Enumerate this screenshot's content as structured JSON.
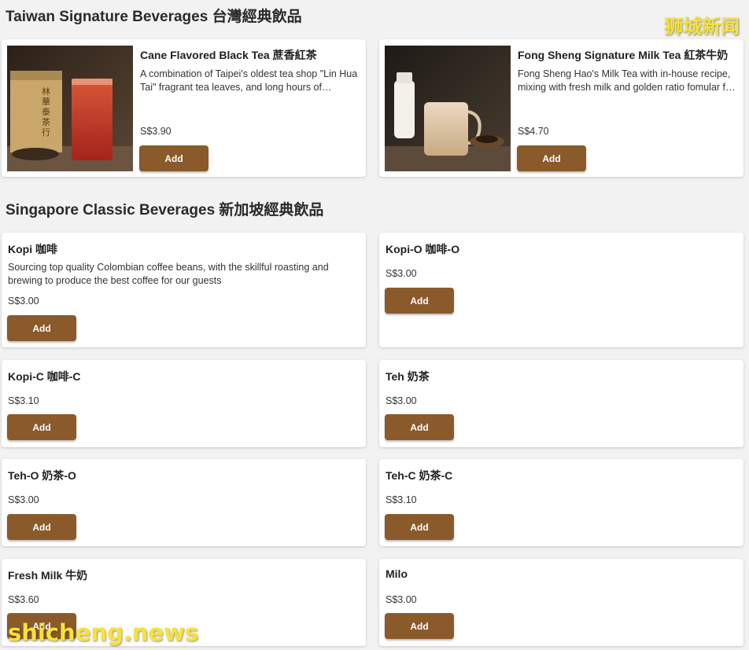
{
  "sections": {
    "taiwan": {
      "title": "Taiwan Signature Beverages 台灣經典飲品"
    },
    "singapore": {
      "title": "Singapore Classic Beverages 新加坡經典飲品"
    }
  },
  "add_label": "Add",
  "taiwan_items": [
    {
      "name": "Cane Flavored Black Tea 蔗香紅茶",
      "description": "A combination of Taipei's oldest tea shop \"Lin Hua Tai\" fragrant tea leaves, and long hours of brewing",
      "price": "S$3.90",
      "image_label": "林華泰茶行"
    },
    {
      "name": "Fong Sheng Signature Milk Tea 紅茶牛奶",
      "description": "Fong Sheng Hao's Milk Tea with in-house recipe, mixing with fresh milk and golden ratio fomular for a smooth taste",
      "price": "S$4.70"
    }
  ],
  "singapore_items": [
    {
      "name": "Kopi 咖啡",
      "description": "Sourcing top quality Colombian coffee beans, with the skillful roasting and brewing to produce the best coffee for our guests",
      "price": "S$3.00"
    },
    {
      "name": "Kopi-O 咖啡-O",
      "price": "S$3.00"
    },
    {
      "name": "Kopi-C 咖啡-C",
      "price": "S$3.10"
    },
    {
      "name": "Teh 奶茶",
      "price": "S$3.00"
    },
    {
      "name": "Teh-O 奶茶-O",
      "price": "S$3.00"
    },
    {
      "name": "Teh-C 奶茶-C",
      "price": "S$3.10"
    },
    {
      "name": "Fresh Milk 牛奶",
      "price": "S$3.60"
    },
    {
      "name": "Milo",
      "price": "S$3.00"
    }
  ],
  "watermarks": {
    "top": "狮城新闻",
    "bottom": "shicheng.news"
  },
  "colors": {
    "button": "#8a5a2b",
    "background": "#f2f2f2",
    "watermark": "#f7e23a"
  }
}
